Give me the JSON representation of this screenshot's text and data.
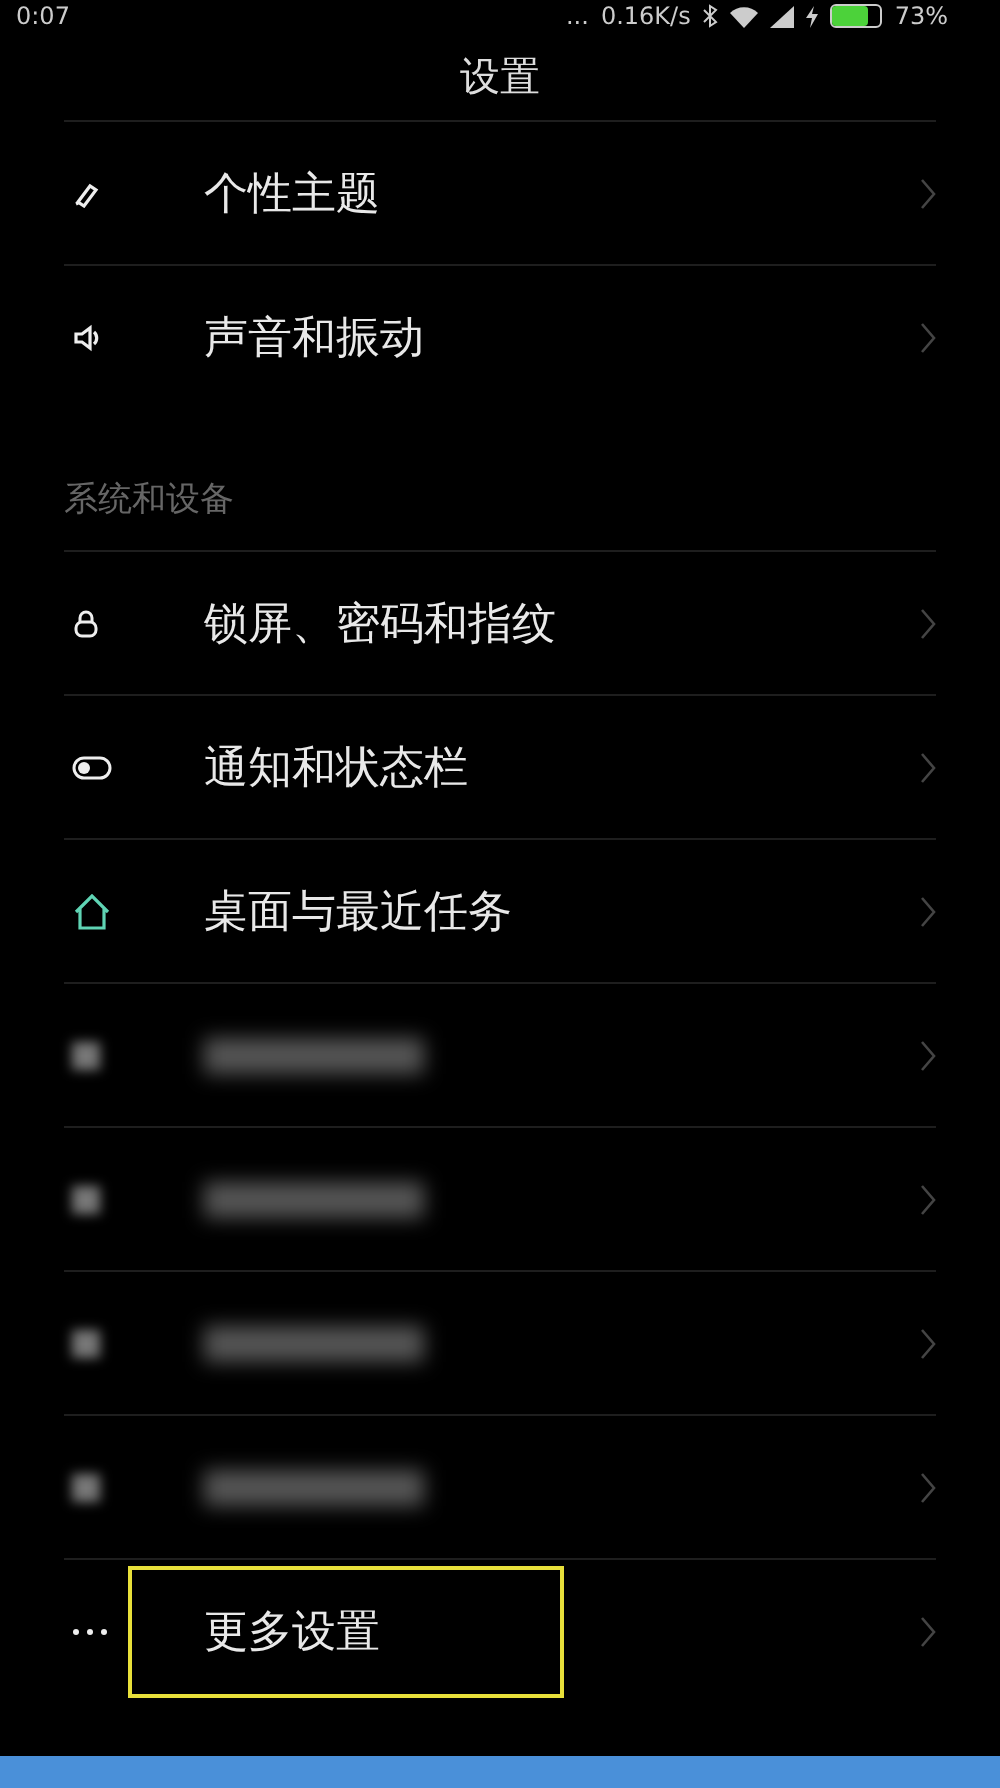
{
  "status_bar": {
    "time": "0:07",
    "more": "...",
    "speed": "0.16K/s",
    "battery": "73%"
  },
  "title": "设置",
  "sections": [
    {
      "items": [
        {
          "kind": "row",
          "label": "个性主题",
          "highlighted": false
        },
        {
          "kind": "row",
          "label": "声音和振动",
          "highlighted": false
        }
      ]
    },
    {
      "header": "系统和设备",
      "items": [
        {
          "kind": "row",
          "label": "锁屏、密码和指纹",
          "highlighted": false
        },
        {
          "kind": "row",
          "label": "通知和状态栏",
          "highlighted": false
        },
        {
          "kind": "row",
          "label": "桌面与最近任务",
          "highlighted": false
        },
        {
          "kind": "blurred",
          "highlighted": false
        },
        {
          "kind": "blurred",
          "highlighted": false
        },
        {
          "kind": "blurred",
          "highlighted": false
        },
        {
          "kind": "blurred",
          "highlighted": false
        },
        {
          "kind": "row",
          "label": "更多设置",
          "highlighted": true
        }
      ]
    }
  ]
}
